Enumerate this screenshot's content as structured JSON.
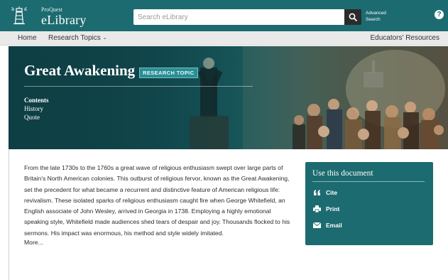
{
  "header": {
    "brand_small": "ProQuest",
    "brand_name": "eLibrary",
    "search_placeholder": "Search eLibrary",
    "advanced_search_line1": "Advanced",
    "advanced_search_line2": "Search",
    "help_label": "?",
    "colors": {
      "bar": "#1c6b70",
      "search_button": "#2b2b2b"
    },
    "icons": [
      "lighthouse-logo-icon",
      "search-icon",
      "help-icon"
    ]
  },
  "nav": {
    "home": "Home",
    "research_topics": "Research Topics",
    "educators_resources": "Educators' Resources"
  },
  "hero": {
    "title": "Great Awakening",
    "badge": "RESEARCH TOPIC",
    "links": [
      "Contents",
      "History",
      "Quote"
    ]
  },
  "article": {
    "body": "From the late 1730s to the 1760s a great wave of religious enthusiasm swept over large parts of Britain's North American colonies. This outburst of religious fervor, known as the Great Awakening, set the precedent for what became a recurrent and distinctive feature of American religious life: revivalism. These isolated sparks of religious enthusiasm caught fire when George Whitefield, an English associate of John Wesley, arrived in Georgia in 1738. Employing a highly emotional speaking style, Whitefield made audiences shed tears of despair and joy. Thousands flocked to his sermons. His impact was enormous, his method and style widely imitated.",
    "more": "More..."
  },
  "doc_panel": {
    "title": "Use this document",
    "items": [
      {
        "label": "Cite",
        "icon": "quote-icon"
      },
      {
        "label": "Print",
        "icon": "printer-icon"
      },
      {
        "label": "Email",
        "icon": "envelope-icon"
      }
    ],
    "color": "#1c6b70"
  }
}
